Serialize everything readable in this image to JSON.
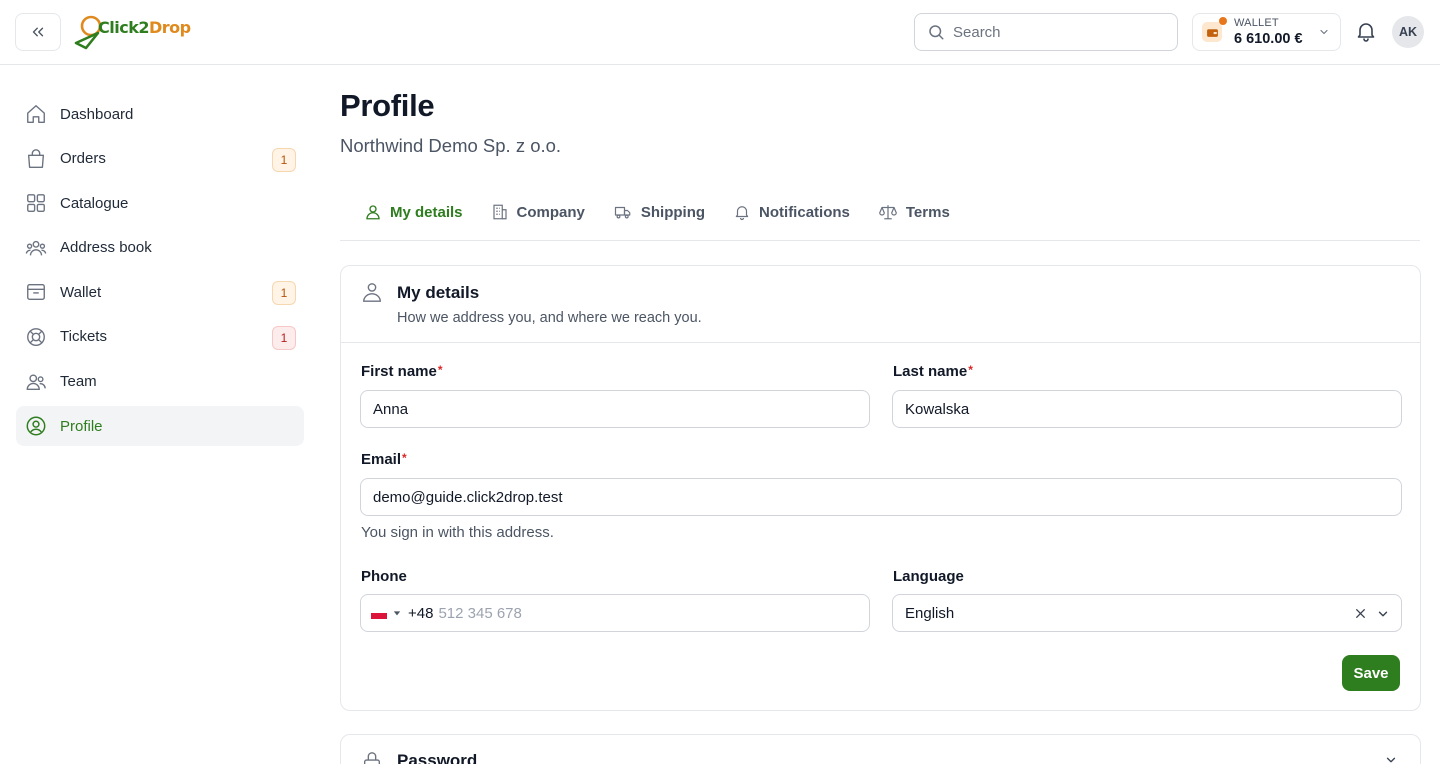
{
  "brand": {
    "name_part1": "Click2",
    "name_part2": "Drop"
  },
  "search": {
    "placeholder": "Search"
  },
  "wallet": {
    "label": "WALLET",
    "amount": "6 610.00 €"
  },
  "user": {
    "initials": "AK"
  },
  "sidebar": {
    "items": [
      {
        "label": "Dashboard",
        "icon": "home-icon"
      },
      {
        "label": "Orders",
        "icon": "shopping-bag-icon",
        "badge": "1"
      },
      {
        "label": "Catalogue",
        "icon": "grid-icon"
      },
      {
        "label": "Address book",
        "icon": "users-group-icon"
      },
      {
        "label": "Wallet",
        "icon": "wallet-icon",
        "badge": "1"
      },
      {
        "label": "Tickets",
        "icon": "lifebuoy-icon",
        "badge": "1"
      },
      {
        "label": "Team",
        "icon": "team-icon"
      },
      {
        "label": "Profile",
        "icon": "user-circle-icon",
        "active": true
      }
    ]
  },
  "page": {
    "title": "Profile",
    "subtitle": "Northwind Demo Sp. z o.o."
  },
  "tabs": [
    {
      "label": "My details",
      "icon": "user-icon",
      "active": true
    },
    {
      "label": "Company",
      "icon": "building-icon"
    },
    {
      "label": "Shipping",
      "icon": "truck-icon"
    },
    {
      "label": "Notifications",
      "icon": "bell-icon"
    },
    {
      "label": "Terms",
      "icon": "scale-icon"
    }
  ],
  "details_card": {
    "title": "My details",
    "description": "How we address you, and where we reach you.",
    "first_name": {
      "label": "First name",
      "required": "*",
      "value": "Anna"
    },
    "last_name": {
      "label": "Last name",
      "required": "*",
      "value": "Kowalska"
    },
    "email": {
      "label": "Email",
      "required": "*",
      "value": "demo@guide.click2drop.test",
      "hint": "You sign in with this address."
    },
    "phone": {
      "label": "Phone",
      "prefix": "+48",
      "placeholder": "512 345 678"
    },
    "language": {
      "label": "Language",
      "value": "English"
    },
    "save_label": "Save"
  },
  "password_card": {
    "title": "Password"
  },
  "colors": {
    "accent": "#2e7d1e",
    "brand_orange": "#e08a1e",
    "required": "#dc2626"
  }
}
